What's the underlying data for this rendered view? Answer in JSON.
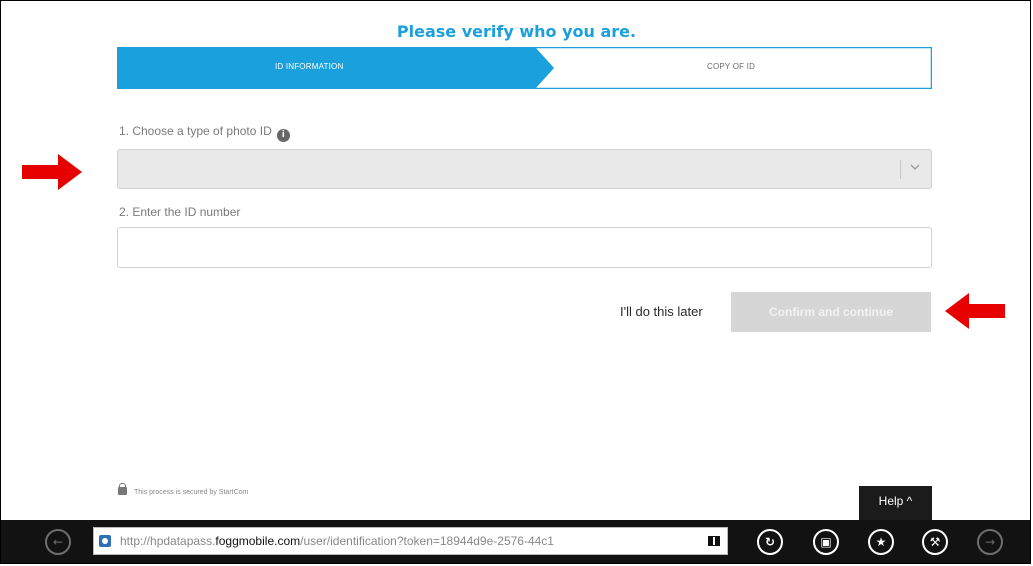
{
  "page": {
    "title": "Please verify who you are."
  },
  "stepper": {
    "steps": [
      {
        "label": "ID INFORMATION",
        "active": true
      },
      {
        "label": "COPY OF ID",
        "active": false
      }
    ],
    "active_color": "#1aa0dc"
  },
  "form": {
    "id_type_label": "1. Choose a type of photo ID",
    "id_type_info_icon": "info-icon",
    "id_type_value": "",
    "id_number_label": "2. Enter the ID number",
    "id_number_value": ""
  },
  "actions": {
    "later_label": "I'll do this later",
    "confirm_label": "Confirm and continue"
  },
  "footer": {
    "secure_text": "This process is secured by StartCom",
    "help_label": "Help ^"
  },
  "browser": {
    "url_prefix": "http://hpdatapass.",
    "url_domain": "foggmobile.com",
    "url_rest": "/user/identification?token=18944d9e-2576-44c1",
    "buttons": [
      "back-icon",
      "refresh-icon",
      "tabs-icon",
      "favorites-icon",
      "tools-icon",
      "forward-icon"
    ]
  },
  "annotations": {
    "arrow_color": "#e60000"
  }
}
